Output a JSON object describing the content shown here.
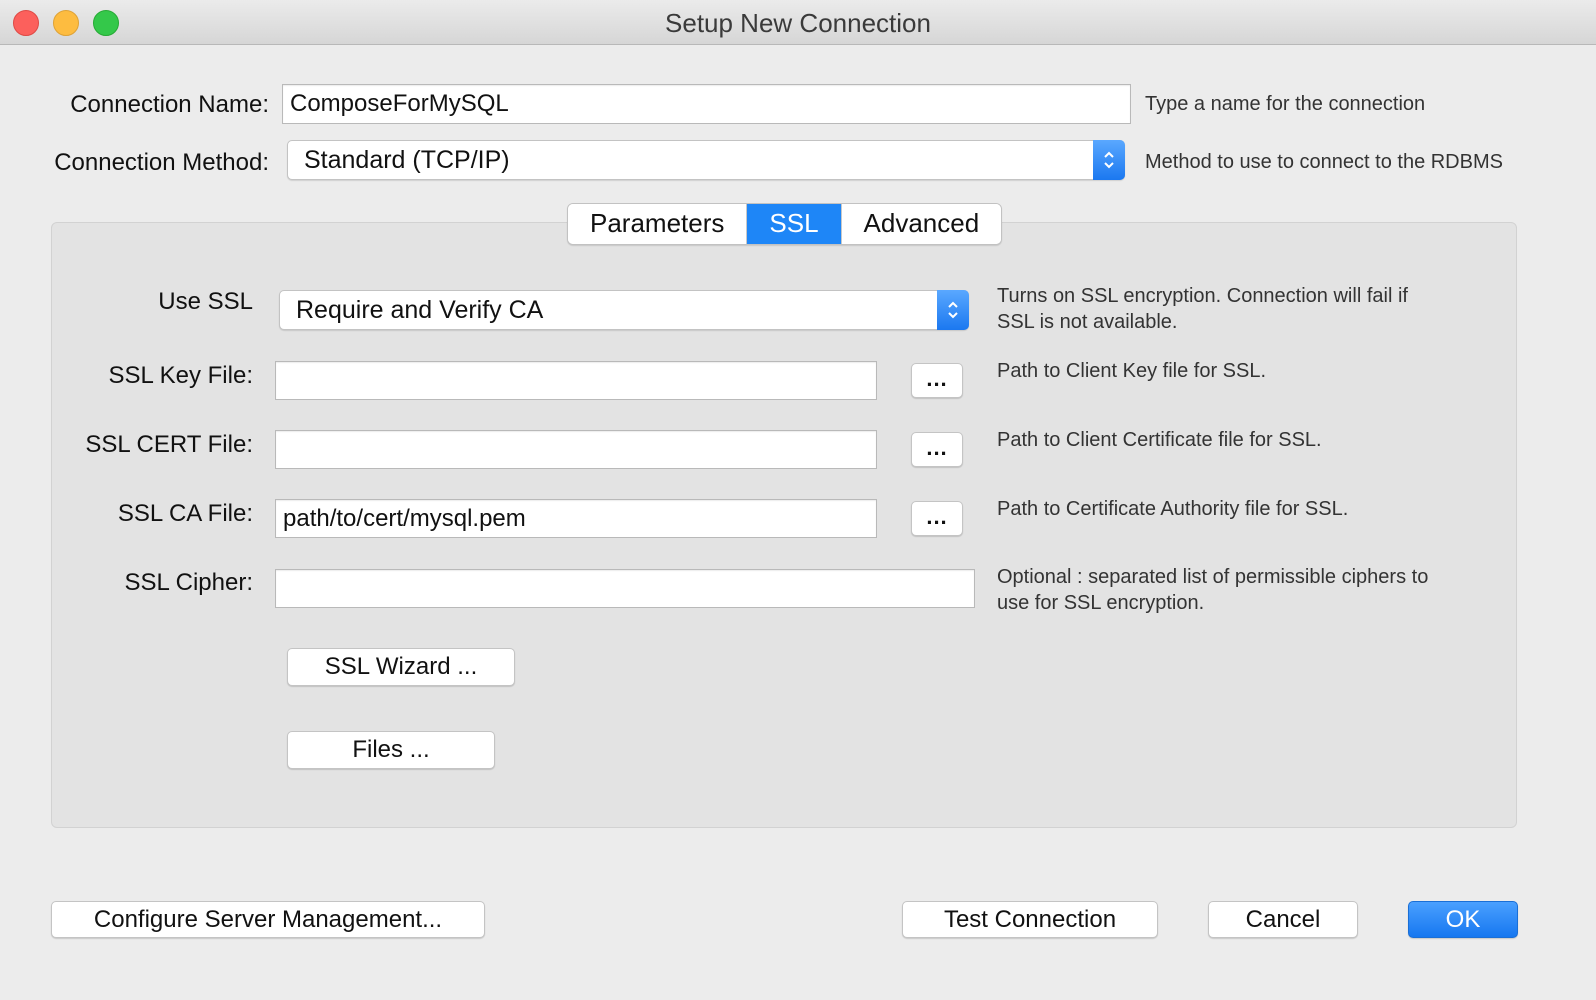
{
  "window": {
    "title": "Setup New Connection"
  },
  "connection_name": {
    "label": "Connection Name:",
    "value": "ComposeForMySQL",
    "hint": "Type a name for the connection"
  },
  "connection_method": {
    "label": "Connection Method:",
    "value": "Standard (TCP/IP)",
    "hint": "Method to use to connect to the RDBMS"
  },
  "tabs": [
    {
      "label": "Parameters",
      "active": false
    },
    {
      "label": "SSL",
      "active": true
    },
    {
      "label": "Advanced",
      "active": false
    }
  ],
  "ssl": {
    "use_ssl": {
      "label": "Use SSL",
      "value": "Require and Verify CA",
      "hint_line1": "Turns on SSL encryption. Connection will fail if",
      "hint_line2": "SSL is not available."
    },
    "key_file": {
      "label": "SSL Key File:",
      "value": "",
      "browse": "...",
      "hint": "Path to Client Key file for SSL."
    },
    "cert_file": {
      "label": "SSL CERT File:",
      "value": "",
      "browse": "...",
      "hint": "Path to Client Certificate file for SSL."
    },
    "ca_file": {
      "label": "SSL CA File:",
      "value": "path/to/cert/mysql.pem",
      "browse": "...",
      "hint": "Path to Certificate Authority file for SSL."
    },
    "cipher": {
      "label": "SSL Cipher:",
      "value": "",
      "hint_line1": "Optional : separated list of permissible ciphers to",
      "hint_line2": "use for SSL encryption."
    },
    "wizard_button": "SSL Wizard ...",
    "files_button": "Files ..."
  },
  "footer": {
    "configure_button": "Configure Server Management...",
    "test_button": "Test Connection",
    "cancel_button": "Cancel",
    "ok_button": "OK"
  },
  "colors": {
    "accent": "#1e86f7",
    "window_bg": "#ececec",
    "panel_bg": "#e3e3e3"
  }
}
